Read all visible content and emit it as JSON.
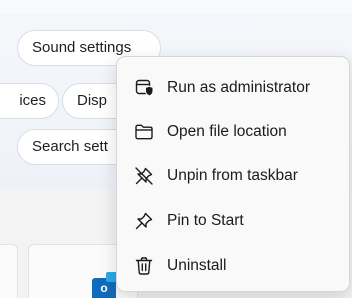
{
  "background_pills": {
    "sound_settings": "Sound settings",
    "devices": "ices",
    "display": "Disp",
    "search_settings": "Search sett"
  },
  "app_icon": {
    "name": "outlook-icon",
    "letter": "o",
    "color": "#0f6cbd"
  },
  "context_menu": {
    "items": [
      {
        "label": "Run as administrator",
        "icon": "shield-window-icon"
      },
      {
        "label": "Open file location",
        "icon": "folder-icon"
      },
      {
        "label": "Unpin from taskbar",
        "icon": "unpin-icon"
      },
      {
        "label": "Pin to Start",
        "icon": "pin-icon"
      },
      {
        "label": "Uninstall",
        "icon": "trash-icon"
      }
    ]
  }
}
